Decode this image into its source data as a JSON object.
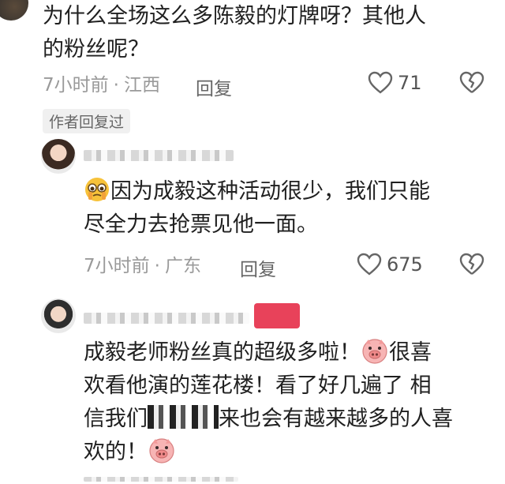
{
  "comments": [
    {
      "text_line1": "为什么全场这么多陈毅的灯牌呀？其他人",
      "text_line2": "的粉丝呢？",
      "time": "7小时前",
      "location": "江西",
      "reply_label": "回复",
      "likes": "71",
      "author_tag": "作者回复过"
    },
    {
      "text_line1": "因为成毅这种活动很少，我们只能",
      "text_line2": "尽全力去抢票见他一面。",
      "time": "7小时前",
      "location": "广东",
      "reply_label": "回复",
      "likes": "675"
    },
    {
      "text_line1": "成毅老师粉丝真的超级多啦！",
      "text_line1b": "很喜",
      "text_line2": "欢看他演的莲花楼！看了好几遍了 相",
      "text_line3a": "信我们",
      "text_line3b": "来也会有越来越多的人喜",
      "text_line4": "欢的！"
    }
  ],
  "icons": {
    "like": "heart-outline-icon",
    "dislike": "broken-heart-icon"
  }
}
